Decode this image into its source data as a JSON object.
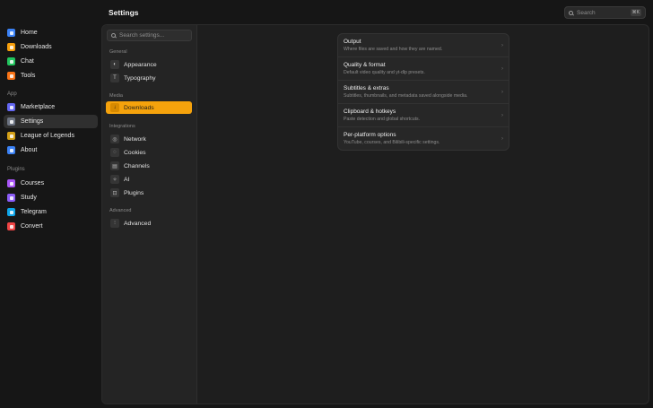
{
  "header": {
    "title": "Settings",
    "search_placeholder": "Search",
    "search_shortcut": "⌘K"
  },
  "sidebar": {
    "top_items": [
      {
        "label": "Home",
        "icon": "home-icon",
        "color": "#3b82f6"
      },
      {
        "label": "Downloads",
        "icon": "download-icon",
        "color": "#f59e0b"
      },
      {
        "label": "Chat",
        "icon": "chat-icon",
        "color": "#22c55e"
      },
      {
        "label": "Tools",
        "icon": "tools-icon",
        "color": "#f97316"
      }
    ],
    "app_label": "App",
    "app_items": [
      {
        "label": "Marketplace",
        "icon": "marketplace-icon",
        "color": "#6366f1"
      },
      {
        "label": "Settings",
        "icon": "gear-icon",
        "color": "#6b7280",
        "active": true
      },
      {
        "label": "League of Legends",
        "icon": "sword-icon",
        "color": "#d4a017"
      },
      {
        "label": "About",
        "icon": "info-icon",
        "color": "#3b82f6"
      }
    ],
    "plugins_label": "Plugins",
    "plugin_items": [
      {
        "label": "Courses",
        "icon": "courses-icon",
        "color": "#a855f7"
      },
      {
        "label": "Study",
        "icon": "study-icon",
        "color": "#8b5cf6"
      },
      {
        "label": "Telegram",
        "icon": "telegram-icon",
        "color": "#0ea5e9"
      },
      {
        "label": "Convert",
        "icon": "convert-icon",
        "color": "#ef4444"
      }
    ]
  },
  "settings_nav": {
    "search_placeholder": "Search settings...",
    "general_label": "General",
    "general_items": [
      {
        "label": "Appearance",
        "icon": "palette-icon",
        "glyph": "◐"
      },
      {
        "label": "Typography",
        "icon": "typography-icon",
        "glyph": "T"
      }
    ],
    "media_label": "Media",
    "media_items": [
      {
        "label": "Downloads",
        "icon": "download-icon",
        "glyph": "↓",
        "active": true
      }
    ],
    "integrations_label": "Integrations",
    "integration_items": [
      {
        "label": "Network",
        "icon": "network-icon",
        "glyph": "◎"
      },
      {
        "label": "Cookies",
        "icon": "cookie-icon",
        "glyph": "◌"
      },
      {
        "label": "Channels",
        "icon": "channels-icon",
        "glyph": "▤"
      },
      {
        "label": "AI",
        "icon": "ai-sparkle-icon",
        "glyph": "✧"
      },
      {
        "label": "Plugins",
        "icon": "plugin-icon",
        "glyph": "⊡"
      }
    ],
    "advanced_label": "Advanced",
    "advanced_items": [
      {
        "label": "Advanced",
        "icon": "sliders-icon",
        "glyph": "⫶"
      }
    ]
  },
  "options": [
    {
      "title": "Output",
      "description": "Where files are saved and how they are named."
    },
    {
      "title": "Quality & format",
      "description": "Default video quality and yt-dlp presets."
    },
    {
      "title": "Subtitles & extras",
      "description": "Subtitles, thumbnails, and metadata saved alongside media."
    },
    {
      "title": "Clipboard & hotkeys",
      "description": "Paste detection and global shortcuts."
    },
    {
      "title": "Per-platform options",
      "description": "YouTube, courses, and Bilibili-specific settings."
    }
  ],
  "colors": {
    "accent": "#f5a20c",
    "background": "#161616",
    "panel": "#1e1e1e"
  }
}
